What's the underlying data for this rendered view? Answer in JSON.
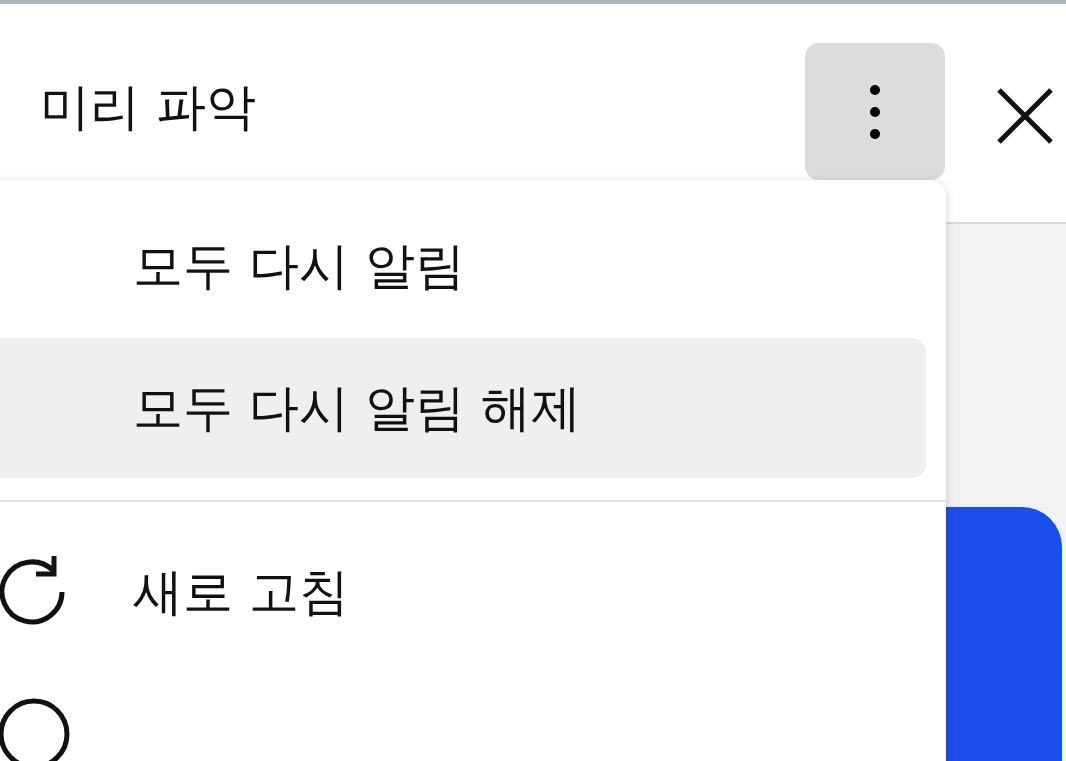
{
  "header": {
    "title": "미리 파악"
  },
  "menu": {
    "open": true,
    "sections": [
      [
        {
          "label": "모두 다시 알림",
          "kind": "plain",
          "selected": false
        },
        {
          "label": "모두 다시 알림 해제",
          "kind": "plain",
          "selected": true
        }
      ],
      [
        {
          "label": "새로 고침",
          "kind": "refresh",
          "selected": false
        },
        {
          "kind": "circle",
          "selected": false
        }
      ]
    ]
  }
}
